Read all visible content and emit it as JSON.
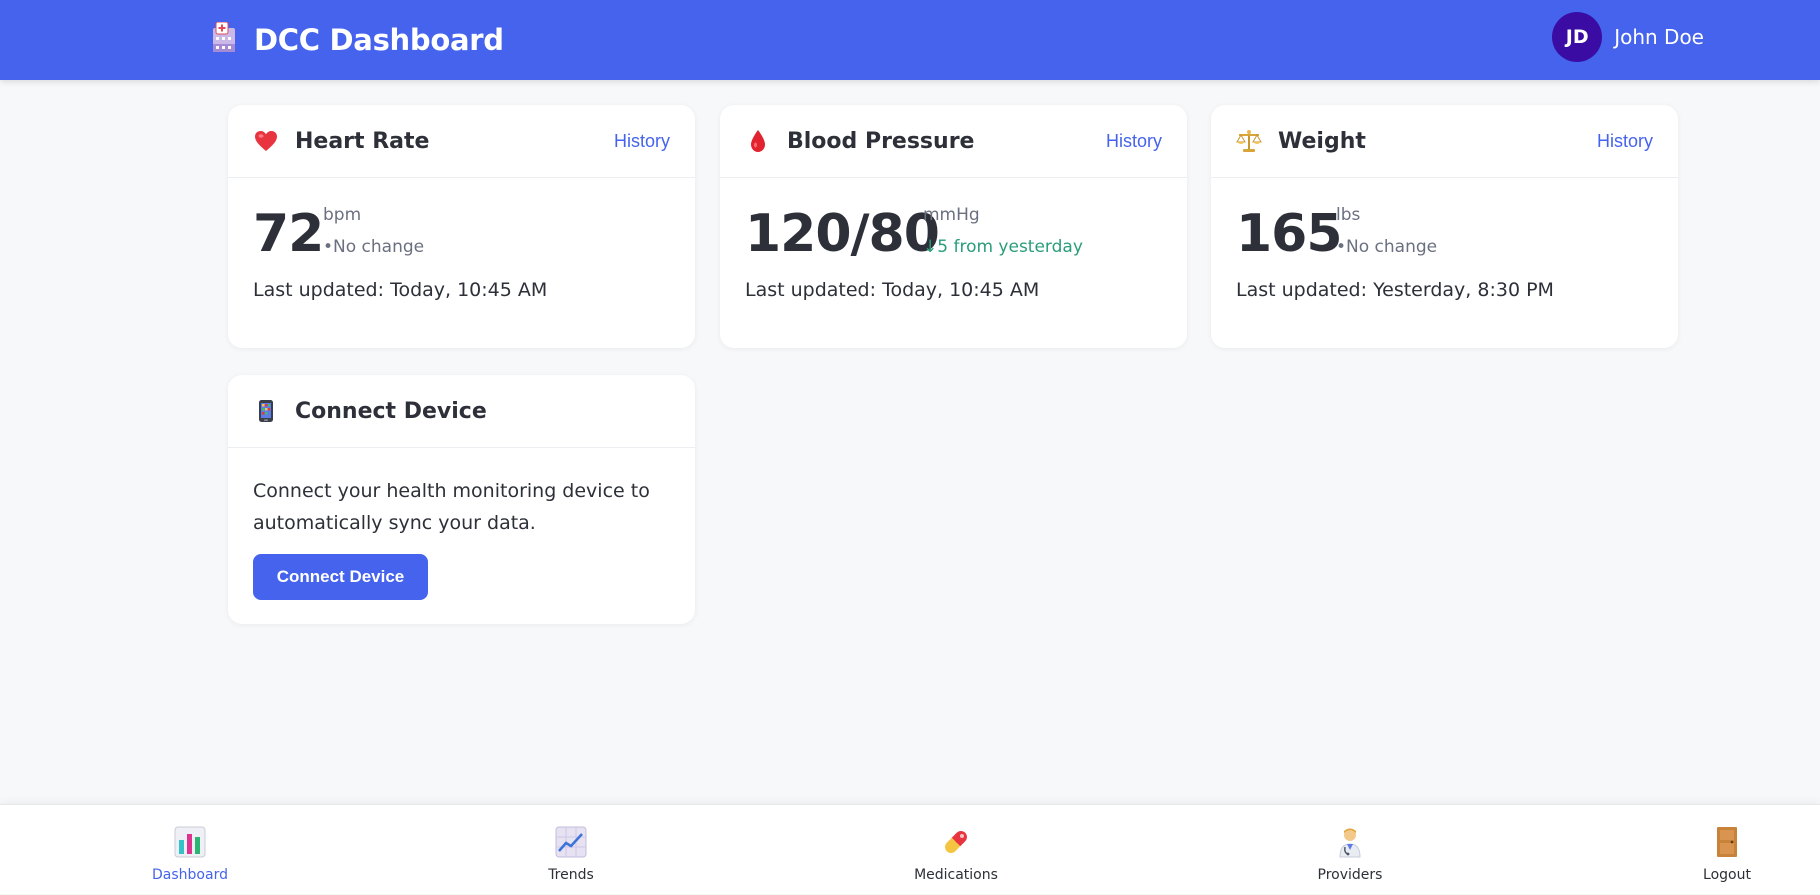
{
  "header": {
    "title": "DCC Dashboard",
    "logo_icon": "hospital-icon",
    "user": {
      "initials": "JD",
      "name": "John Doe"
    }
  },
  "cards": {
    "heart_rate": {
      "icon": "heart-icon",
      "title": "Heart Rate",
      "link": "History",
      "value": "72",
      "unit": "bpm",
      "change": "•No change",
      "updated": "Last updated: Today, 10:45 AM"
    },
    "blood_pressure": {
      "icon": "blood-drop-icon",
      "title": "Blood Pressure",
      "link": "History",
      "value": "120/80",
      "unit": "mmHg",
      "change": "↓5 from yesterday",
      "updated": "Last updated: Today, 10:45 AM"
    },
    "weight": {
      "icon": "scale-icon",
      "title": "Weight",
      "link": "History",
      "value": "165",
      "unit": "lbs",
      "change": "•No change",
      "updated": "Last updated: Yesterday, 8:30 PM"
    },
    "connect": {
      "icon": "phone-icon",
      "title": "Connect Device",
      "text": "Connect your health monitoring device to automatically sync your data.",
      "button": "Connect Device"
    }
  },
  "nav": [
    {
      "label": "Dashboard",
      "icon": "bar-chart-icon",
      "active": true
    },
    {
      "label": "Trends",
      "icon": "trend-chart-icon",
      "active": false
    },
    {
      "label": "Medications",
      "icon": "pill-icon",
      "active": false
    },
    {
      "label": "Providers",
      "icon": "doctor-icon",
      "active": false
    },
    {
      "label": "Logout",
      "icon": "door-icon",
      "active": false
    }
  ],
  "colors": {
    "primary": "#4563ec",
    "avatar": "#3a0ca3",
    "positive": "#2a9d7a",
    "background": "#f7f8fa"
  }
}
